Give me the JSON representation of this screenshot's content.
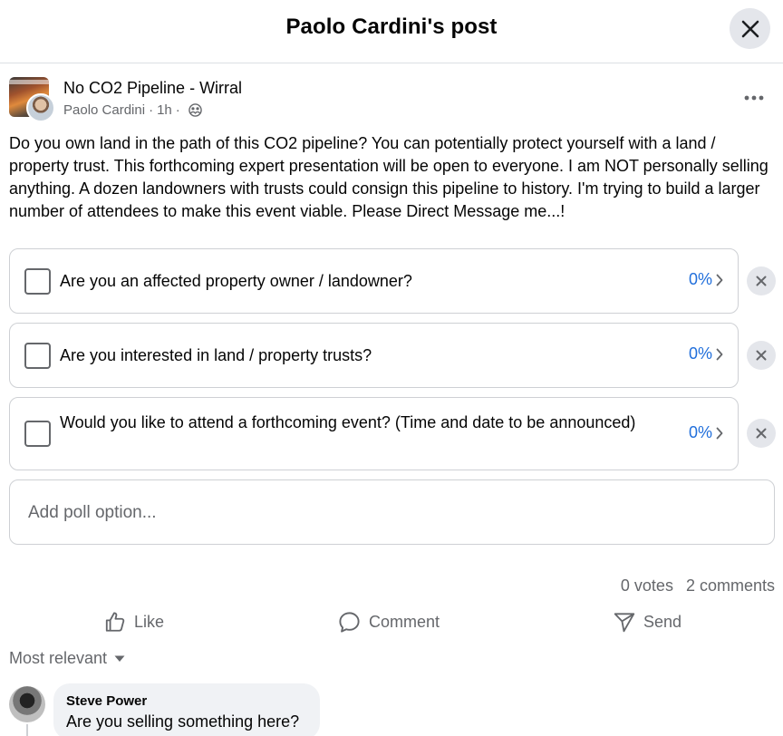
{
  "header": {
    "title": "Paolo Cardini's post"
  },
  "post": {
    "group_name": "No CO2 Pipeline - Wirral",
    "author": "Paolo Cardini",
    "time": "1h",
    "text": "Do you own land in the path of this CO2 pipeline? You can potentially protect yourself with a land / property trust. This forthcoming expert presentation will be open to everyone. I am NOT personally selling anything. A dozen landowners with trusts could consign this pipeline to history. I'm trying to build a larger number of attendees to make this event viable. Please Direct Message me...!"
  },
  "poll": {
    "options": [
      {
        "label": "Are you an affected property owner / landowner?",
        "percent": "0%"
      },
      {
        "label": "Are you interested in land / property trusts?",
        "percent": "0%"
      },
      {
        "label": "Would you like to attend a forthcoming event? (Time and date to be announced)",
        "percent": "0%"
      }
    ],
    "add_placeholder": "Add poll option..."
  },
  "stats": {
    "votes": "0 votes",
    "comments": "2 comments"
  },
  "actions": {
    "like": "Like",
    "comment": "Comment",
    "send": "Send"
  },
  "comments": {
    "sort_label": "Most relevant",
    "items": [
      {
        "author": "Steve Power",
        "text": "Are you selling something here?"
      }
    ]
  },
  "colors": {
    "accent": "#216fdb",
    "secondary_text": "#65676b",
    "bubble_bg": "#f0f2f5",
    "button_bg": "#e4e6eb"
  },
  "icons": [
    "close-icon",
    "more-icon",
    "globe-icon",
    "chevron-right-icon",
    "remove-icon",
    "like-icon",
    "comment-icon",
    "send-icon",
    "caret-down-icon"
  ]
}
